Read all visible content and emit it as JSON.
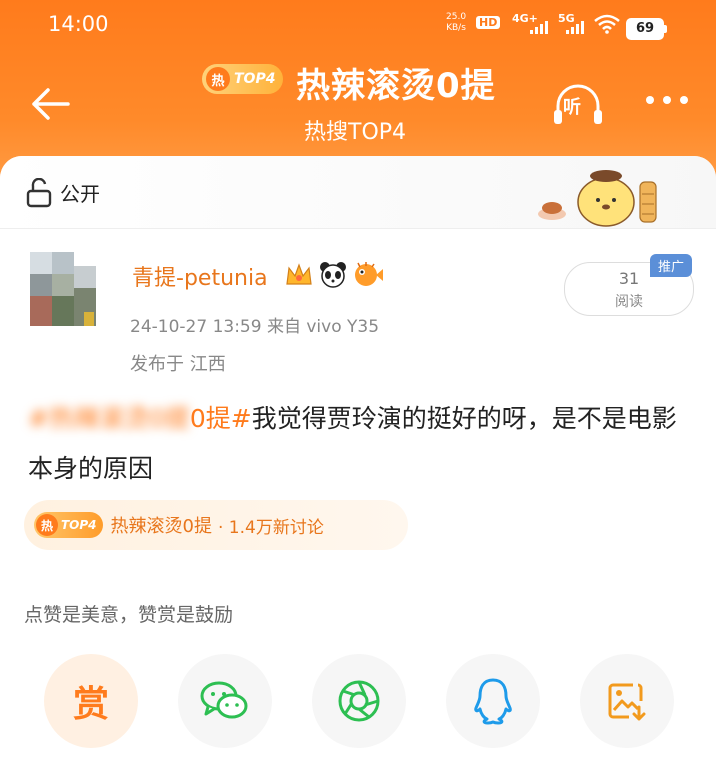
{
  "status_bar": {
    "time": "14:00",
    "net_speed_value": "25.0",
    "net_speed_unit": "KB/s",
    "hd_badge": "HD",
    "network_1": "4G+",
    "network_2": "5G",
    "battery": "69"
  },
  "header": {
    "badge_hot": "热",
    "badge_rank": "TOP4",
    "title": "热辣滚烫0提",
    "subtitle": "热搜TOP4",
    "listen_label": "听"
  },
  "visibility": {
    "label": "公开"
  },
  "post": {
    "author": "青提-petunia",
    "meta": "24-10-27 13:59  来自 vivo Y35",
    "location": "发布于 江西",
    "hashtag_hidden": "#热辣滚烫0提",
    "hashtag_visible": "0提#",
    "body": "我觉得贾玲演的挺好的呀，是不是电影本身的原因",
    "read_count": "31",
    "read_label": "阅读",
    "promo_tag": "推广"
  },
  "topic_chip": {
    "badge_hot": "热",
    "badge_rank": "TOP4",
    "name": "热辣滚烫0提",
    "stat": "· 1.4万新讨论"
  },
  "reward_note": "点赞是美意，赞赏是鼓励",
  "actions": {
    "reward_label": "赏",
    "items": [
      "wechat-icon",
      "moments-icon",
      "qq-icon",
      "save-image-icon"
    ]
  },
  "colors": {
    "accent": "#ff7b1c",
    "link": "#e8761c",
    "promo": "#5b8fd8"
  }
}
